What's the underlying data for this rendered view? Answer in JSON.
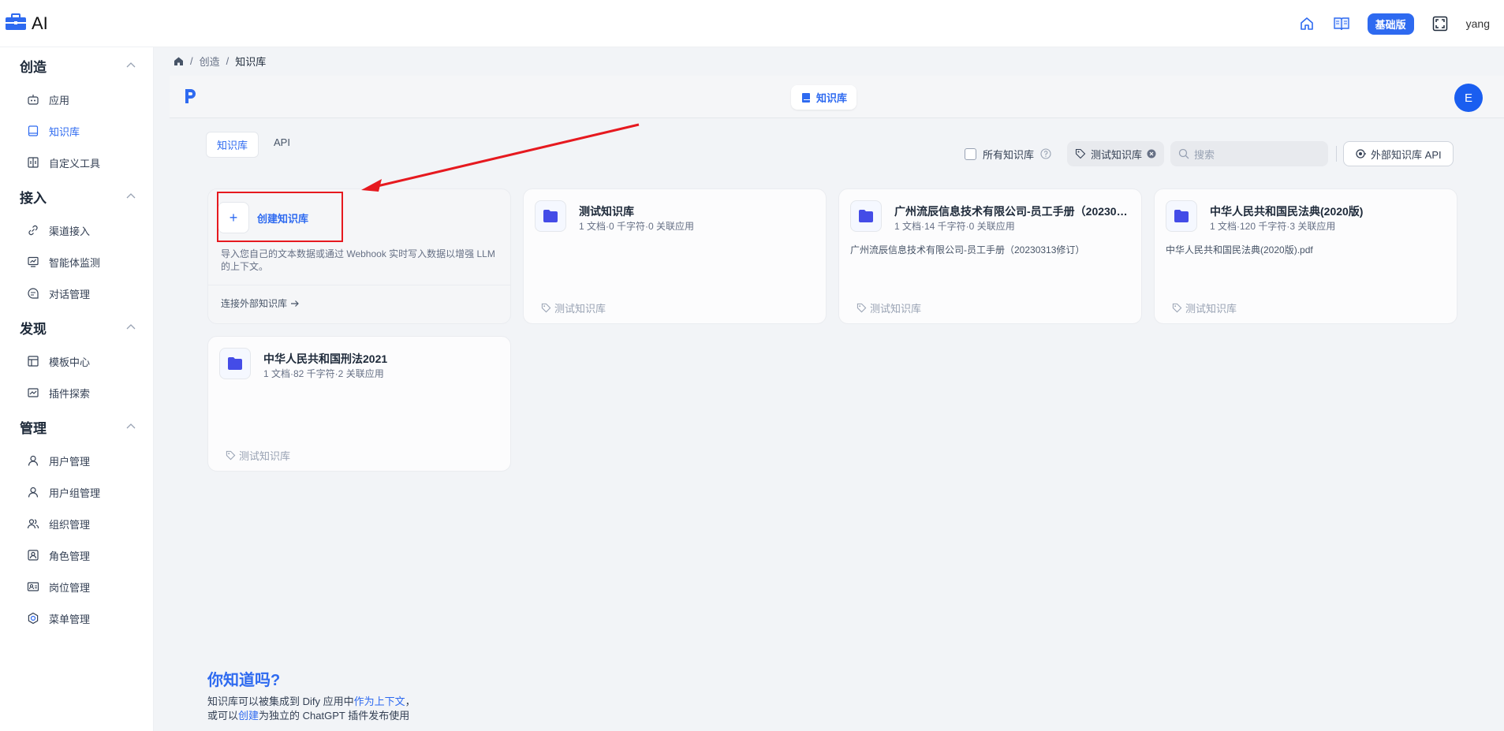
{
  "app": {
    "title": "AI"
  },
  "topbar": {
    "plan_badge": "基础版",
    "username": "yang"
  },
  "sidebar": {
    "groups": [
      {
        "title": "创造",
        "items": [
          {
            "label": "应用",
            "icon": "robot-icon"
          },
          {
            "label": "知识库",
            "icon": "book-icon",
            "active": true
          },
          {
            "label": "自定义工具",
            "icon": "tool-icon"
          }
        ]
      },
      {
        "title": "接入",
        "items": [
          {
            "label": "渠道接入",
            "icon": "link-icon"
          },
          {
            "label": "智能体监测",
            "icon": "monitor-icon"
          },
          {
            "label": "对话管理",
            "icon": "chat-icon"
          }
        ]
      },
      {
        "title": "发现",
        "items": [
          {
            "label": "模板中心",
            "icon": "template-icon"
          },
          {
            "label": "插件探索",
            "icon": "plugin-icon"
          }
        ]
      },
      {
        "title": "管理",
        "items": [
          {
            "label": "用户管理",
            "icon": "user-icon"
          },
          {
            "label": "用户组管理",
            "icon": "user-group-icon"
          },
          {
            "label": "组织管理",
            "icon": "org-icon"
          },
          {
            "label": "角色管理",
            "icon": "role-icon"
          },
          {
            "label": "岗位管理",
            "icon": "post-icon"
          },
          {
            "label": "菜单管理",
            "icon": "menu-icon"
          }
        ]
      }
    ]
  },
  "breadcrumb": {
    "sep": "/",
    "items": [
      "创造",
      "知识库"
    ]
  },
  "header": {
    "center_tab": "知识库",
    "avatar_letter": "E"
  },
  "tabs": [
    "知识库",
    "API"
  ],
  "filters": {
    "all_label": "所有知识库",
    "tag_label": "测试知识库",
    "search_placeholder": "搜索",
    "ext_api_label": "外部知识库 API"
  },
  "create_card": {
    "label": "创建知识库",
    "desc": "导入您自己的文本数据或通过 Webhook 实时写入数据以增强 LLM 的上下文。",
    "connect_label": "连接外部知识库"
  },
  "datasets": [
    {
      "title": "测试知识库",
      "meta": "1 文档·0 千字符·0 关联应用",
      "desc": "",
      "tag": "测试知识库"
    },
    {
      "title": "广州流辰信息技术有限公司-员工手册（20230313修订）",
      "meta": "1 文档·14 千字符·0 关联应用",
      "desc": "广州流辰信息技术有限公司-员工手册（20230313修订）",
      "tag": "测试知识库"
    },
    {
      "title": "中华人民共和国民法典(2020版)",
      "meta": "1 文档·120 千字符·3 关联应用",
      "desc": "中华人民共和国民法典(2020版).pdf",
      "tag": "测试知识库"
    },
    {
      "title": "中华人民共和国刑法2021",
      "meta": "1 文档·82 千字符·2 关联应用",
      "desc": "",
      "tag": "测试知识库"
    }
  ],
  "tip": {
    "title": "你知道吗?",
    "line1_a": "知识库可以被集成到 Dify 应用中",
    "line1_link": "作为上下文",
    "line1_b": "，",
    "line2_a": "或可以",
    "line2_link": "创建",
    "line2_b": "为独立的 ChatGPT 插件发布使用"
  },
  "colors": {
    "accent": "#2e6af0",
    "annotation": "#e6191f"
  }
}
